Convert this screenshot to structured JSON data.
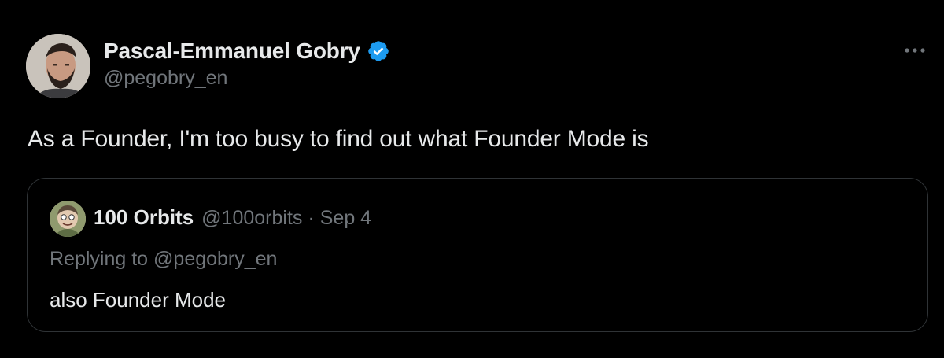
{
  "tweet": {
    "author": {
      "display_name": "Pascal-Emmanuel Gobry",
      "handle": "@pegobry_en",
      "verified": true,
      "avatar_icon": "person-avatar"
    },
    "text": "As a Founder, I'm too busy to find out what Founder Mode is",
    "more_icon": "more-options-icon"
  },
  "quoted_tweet": {
    "author": {
      "display_name": "100 Orbits",
      "handle": "@100orbits",
      "avatar_icon": "person-avatar"
    },
    "separator": "·",
    "date": "Sep 4",
    "replying_prefix": "Replying to",
    "replying_to": "@pegobry_en",
    "text": "also Founder Mode"
  },
  "colors": {
    "background": "#000000",
    "text_primary": "#e7e9ea",
    "text_secondary": "#71767b",
    "border": "#2f3336",
    "verified_blue": "#1d9bf0"
  }
}
